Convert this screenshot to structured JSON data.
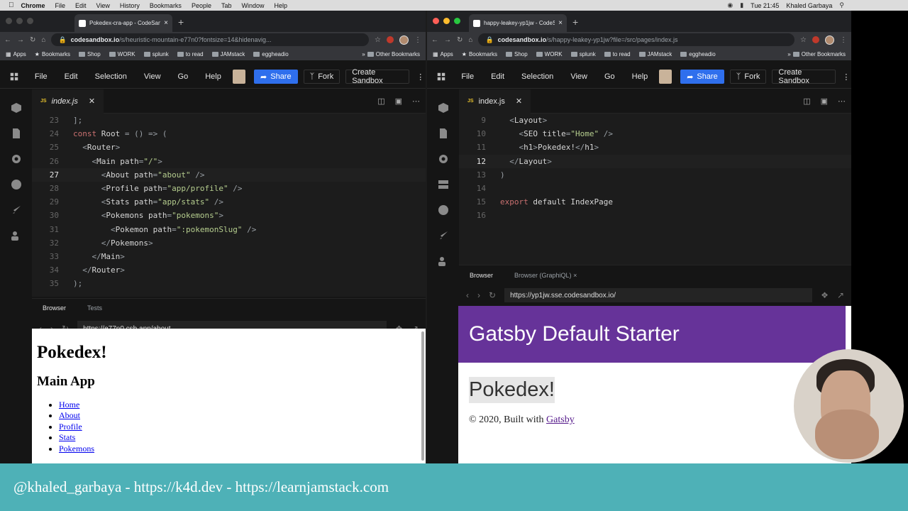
{
  "menubar": {
    "app": "Chrome",
    "items": [
      "File",
      "Edit",
      "View",
      "History",
      "Bookmarks",
      "People",
      "Tab",
      "Window",
      "Help"
    ],
    "clock": "Tue 21:45",
    "user": "Khaled Garbaya"
  },
  "left": {
    "tab_title": "Pokedex-cra-app - CodeSand",
    "url_host": "codesandbox.io",
    "url_path": "/s/heuristic-mountain-e77n0?fontsize=14&hidenavig...",
    "code_lines": [
      {
        "n": "23",
        "t": "];"
      },
      {
        "n": "24",
        "t": "const Root = () => ("
      },
      {
        "n": "25",
        "t": "  <Router>"
      },
      {
        "n": "26",
        "t": "    <Main path=\"/\">"
      },
      {
        "n": "27",
        "t": "      <About path=\"about\" />"
      },
      {
        "n": "28",
        "t": "      <Profile path=\"app/profile\" />"
      },
      {
        "n": "29",
        "t": "      <Stats path=\"app/stats\" />"
      },
      {
        "n": "30",
        "t": "      <Pokemons path=\"pokemons\">"
      },
      {
        "n": "31",
        "t": "        <Pokemon path=\":pokemonSlug\" />"
      },
      {
        "n": "32",
        "t": "      </Pokemons>"
      },
      {
        "n": "33",
        "t": "    </Main>"
      },
      {
        "n": "34",
        "t": "  </Router>"
      },
      {
        "n": "35",
        "t": ");"
      }
    ],
    "active_line": "27",
    "panel_tabs": [
      "Browser",
      "Tests"
    ],
    "preview_url": "https://e77n0.csb.app/about",
    "preview": {
      "h1": "Pokedex!",
      "h2": "Main App",
      "links": [
        "Home",
        "About",
        "Profile",
        "Stats",
        "Pokemons"
      ]
    }
  },
  "right": {
    "tab_title": "happy-leakey-yp1jw - CodeSa",
    "url_host": "codesandbox.io",
    "url_path": "/s/happy-leakey-yp1jw?file=/src/pages/index.js",
    "code_lines": [
      {
        "n": "9",
        "t": "  <Layout>"
      },
      {
        "n": "10",
        "t": "    <SEO title=\"Home\" />"
      },
      {
        "n": "11",
        "t": "    <h1>Pokedex!</h1>"
      },
      {
        "n": "12",
        "t": "  </Layout>"
      },
      {
        "n": "13",
        "t": ")"
      },
      {
        "n": "14",
        "t": ""
      },
      {
        "n": "15",
        "t": "export default IndexPage"
      },
      {
        "n": "16",
        "t": ""
      }
    ],
    "active_line": "12",
    "panel_tabs": [
      "Browser",
      "Browser (GraphiQL)"
    ],
    "preview_url": "https://yp1jw.sse.codesandbox.io/",
    "preview": {
      "header": "Gatsby Default Starter",
      "h1": "Pokedex!",
      "footer_prefix": "© 2020, Built with",
      "footer_link": "Gatsby"
    }
  },
  "bookmarks": [
    "Apps",
    "Bookmarks",
    "Shop",
    "WORK",
    "splunk",
    "to read",
    "JAMstack",
    "eggheadio"
  ],
  "other_bookmarks": "Other Bookmarks",
  "codesandbox": {
    "menus": [
      "File",
      "Edit",
      "Selection",
      "View",
      "Go",
      "Help"
    ],
    "share": "Share",
    "fork": "Fork",
    "create": "Create Sandbox",
    "file_tab": "index.js",
    "file_badge": "JS"
  },
  "banner": "@khaled_garbaya - https://k4d.dev - https://learnjamstack.com",
  "colors": {
    "gatsby_purple": "#663399",
    "share_blue": "#2f6fed",
    "banner_teal": "#4eb1b7"
  }
}
